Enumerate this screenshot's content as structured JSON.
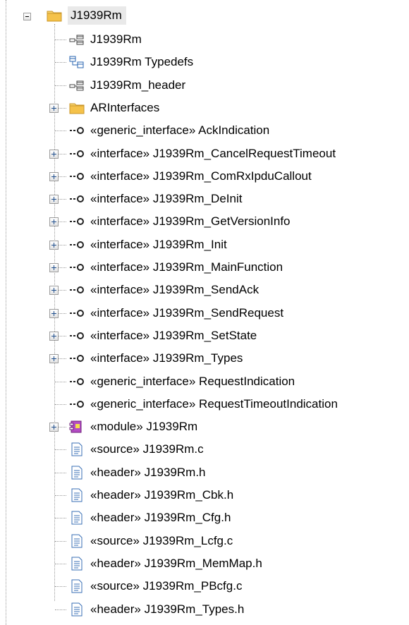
{
  "root": {
    "label": "J1939Rm",
    "expanded": true,
    "icon": "folder-icon"
  },
  "items": [
    {
      "label": "J1939Rm",
      "icon": "diagram-package-icon",
      "expandable": false
    },
    {
      "label": "J1939Rm Typedefs",
      "icon": "diagram-class-icon",
      "expandable": false
    },
    {
      "label": "J1939Rm_header",
      "icon": "diagram-package-icon",
      "expandable": false
    },
    {
      "label": "ARInterfaces",
      "icon": "folder-icon",
      "expandable": true
    },
    {
      "label": "«generic_interface» AckIndication",
      "icon": "interface-lollipop-icon",
      "expandable": false
    },
    {
      "label": "«interface» J1939Rm_CancelRequestTimeout",
      "icon": "interface-lollipop-icon",
      "expandable": true
    },
    {
      "label": "«interface» J1939Rm_ComRxIpduCallout",
      "icon": "interface-lollipop-icon",
      "expandable": true
    },
    {
      "label": "«interface» J1939Rm_DeInit",
      "icon": "interface-lollipop-icon",
      "expandable": true
    },
    {
      "label": "«interface» J1939Rm_GetVersionInfo",
      "icon": "interface-lollipop-icon",
      "expandable": true
    },
    {
      "label": "«interface» J1939Rm_Init",
      "icon": "interface-lollipop-icon",
      "expandable": true
    },
    {
      "label": "«interface» J1939Rm_MainFunction",
      "icon": "interface-lollipop-icon",
      "expandable": true
    },
    {
      "label": "«interface» J1939Rm_SendAck",
      "icon": "interface-lollipop-icon",
      "expandable": true
    },
    {
      "label": "«interface» J1939Rm_SendRequest",
      "icon": "interface-lollipop-icon",
      "expandable": true
    },
    {
      "label": "«interface» J1939Rm_SetState",
      "icon": "interface-lollipop-icon",
      "expandable": true
    },
    {
      "label": "«interface» J1939Rm_Types",
      "icon": "interface-lollipop-icon",
      "expandable": true
    },
    {
      "label": "«generic_interface» RequestIndication",
      "icon": "interface-lollipop-icon",
      "expandable": false
    },
    {
      "label": "«generic_interface» RequestTimeoutIndication",
      "icon": "interface-lollipop-icon",
      "expandable": false
    },
    {
      "label": "«module» J1939Rm",
      "icon": "module-icon",
      "expandable": true
    },
    {
      "label": "«source» J1939Rm.c",
      "icon": "file-icon",
      "expandable": false
    },
    {
      "label": "«header» J1939Rm.h",
      "icon": "file-icon",
      "expandable": false
    },
    {
      "label": "«header» J1939Rm_Cbk.h",
      "icon": "file-icon",
      "expandable": false
    },
    {
      "label": "«header» J1939Rm_Cfg.h",
      "icon": "file-icon",
      "expandable": false
    },
    {
      "label": "«source» J1939Rm_Lcfg.c",
      "icon": "file-icon",
      "expandable": false
    },
    {
      "label": "«header» J1939Rm_MemMap.h",
      "icon": "file-icon",
      "expandable": false
    },
    {
      "label": "«source» J1939Rm_PBcfg.c",
      "icon": "file-icon",
      "expandable": false
    },
    {
      "label": "«header» J1939Rm_Types.h",
      "icon": "file-icon",
      "expandable": false
    }
  ],
  "colors": {
    "folder": "#f5c24a",
    "selection": "#e9e9e9",
    "file": "#3a6fb5",
    "module": "#9b3aa8"
  }
}
